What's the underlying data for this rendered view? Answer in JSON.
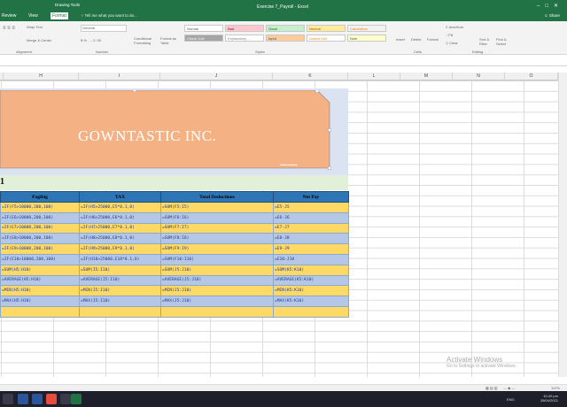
{
  "titlebar": {
    "contextual_tab_group": "Drawing Tools",
    "document_title": "Exercise 7_Payroll - Excel",
    "tabs": [
      "Review",
      "View",
      "Format"
    ],
    "active_tab": "Format",
    "tell_me": "Tell me what you want to do...",
    "share": "Share"
  },
  "ribbon": {
    "alignment": {
      "wrap_text": "Wrap Text",
      "merge_center": "Merge & Center",
      "label": "Alignment"
    },
    "number": {
      "format_value": "General",
      "label": "Number"
    },
    "styles": {
      "conditional_formatting": "Conditional Formatting",
      "format_as_table": "Format as Table",
      "cells": [
        {
          "name": "Normal",
          "color": "#ffffff",
          "text": "#555555"
        },
        {
          "name": "Bad",
          "color": "#ffc7ce",
          "text": "#9c0006"
        },
        {
          "name": "Good",
          "color": "#c6efce",
          "text": "#006100"
        },
        {
          "name": "Neutral",
          "color": "#ffeb9c",
          "text": "#9c5700"
        },
        {
          "name": "Calculation",
          "color": "#f2f2f2",
          "text": "#fa7d00"
        },
        {
          "name": "Check Cell",
          "color": "#a5a5a5",
          "text": "#ffffff"
        },
        {
          "name": "Explanatory ...",
          "color": "#ffffff",
          "text": "#7f7f7f"
        },
        {
          "name": "Input",
          "color": "#ffcc99",
          "text": "#3f3f76"
        },
        {
          "name": "Linked Cell",
          "color": "#ffffff",
          "text": "#fa7d00"
        },
        {
          "name": "Note",
          "color": "#ffffcc",
          "text": "#555555"
        }
      ],
      "label": "Styles"
    },
    "cells": {
      "insert": "Insert",
      "delete": "Delete",
      "format": "Format",
      "label": "Cells"
    },
    "editing": {
      "autosum": "AutoSum",
      "fill": "Fill",
      "clear": "Clear",
      "sort_filter": "Sort & Filter",
      "find_select": "Find & Select",
      "label": "Editing"
    }
  },
  "columns": [
    "H",
    "I",
    "J",
    "K",
    "L",
    "M",
    "N",
    "O"
  ],
  "banner": {
    "text": "GOWNTASTIC INC.",
    "fill": "#f4b183"
  },
  "row_fragment": "1",
  "table": {
    "headers": [
      "Pagibig",
      "TAX",
      "Total Deductions",
      "Net Pay"
    ],
    "header_color": "#2e75b6",
    "rows": [
      [
        "=IF(F5>10000,200,100)",
        "=IF(H5>25000,E5*0.1,0)",
        "=SUM(F5:I5)",
        "=E5-J5"
      ],
      [
        "=IF(E6>10000,200,100)",
        "=IF(H6>25000,E6*0.1,0)",
        "=SUM(F6:I6)",
        "=E6-J6"
      ],
      [
        "=IF(E7>10000,200,100)",
        "=IF(H7>25000,E7*0.1,0)",
        "=SUM(F7:I7)",
        "=E7-J7"
      ],
      [
        "=IF(E8>10000,200,100)",
        "=IF(H8>25000,E8*0.1,0)",
        "=SUM(F8:I8)",
        "=E8-J8"
      ],
      [
        "=IF(E9>10000,200,100)",
        "=IF(H9>25000,E9*0.1,0)",
        "=SUM(F9:I9)",
        "=E9-J9"
      ],
      [
        "=IF(E10>10000,200,100)",
        "=IF(H10>25000,E10*0.1,0)",
        "=SUM(F10:I10)",
        "=E10-J10"
      ],
      [
        "=SUM(H5:H10)",
        "=SUM(I5:I10)",
        "=SUM(J5:J10)",
        "=SUM(K5:K10)"
      ],
      [
        "=AVERAGE(H5:H10)",
        "=AVERAGE(I5:I10)",
        "=AVERAGE(J5:J10)",
        "=AVERAGE(K5:K10)"
      ],
      [
        "=MIN(H5:H10)",
        "=MIN(I5:I10)",
        "=MIN(J5:J10)",
        "=MIN(K5:K10)"
      ],
      [
        "=MAX(H5:H10)",
        "=MAX(I5:I10)",
        "=MAX(J5:J10)",
        "=MAX(K5:K10)"
      ],
      [
        "",
        "",
        "",
        ""
      ]
    ]
  },
  "watermark": {
    "line1": "Activate Windows",
    "line2": "Go to Settings to activate Windows."
  },
  "status": {
    "zoom": "112%"
  },
  "taskbar": {
    "lang": "ENG",
    "time": "10:40 pm",
    "date": "28/04/2021"
  }
}
